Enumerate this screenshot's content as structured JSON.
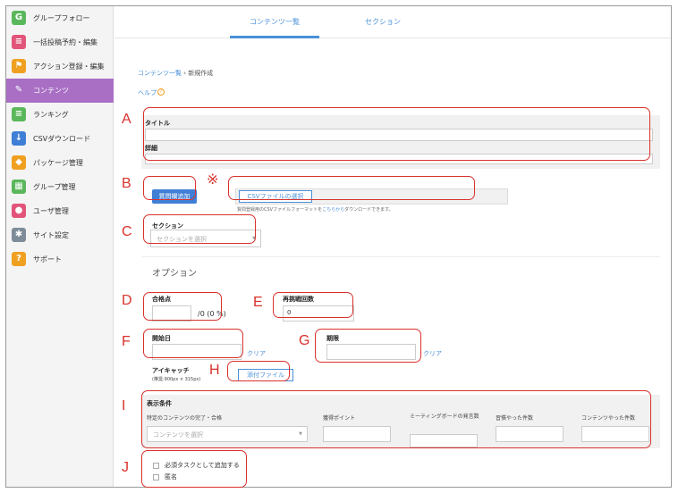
{
  "sidebar": {
    "items": [
      {
        "label": "グループフォロー",
        "icon": "group-follow-icon",
        "color": "#5bb75b",
        "glyph": "G"
      },
      {
        "label": "一括投稿予約・編集",
        "icon": "bulk-post-icon",
        "color": "#e2547a",
        "glyph": "≡"
      },
      {
        "label": "アクション登録・編集",
        "icon": "flag-icon",
        "color": "#f0a020",
        "glyph": "⚑"
      },
      {
        "label": "コンテンツ",
        "icon": "content-icon",
        "color": "#a86fc4",
        "glyph": "✎"
      },
      {
        "label": "ランキング",
        "icon": "ranking-icon",
        "color": "#5bb75b",
        "glyph": "≡"
      },
      {
        "label": "CSVダウンロード",
        "icon": "download-icon",
        "color": "#3f7fd6",
        "glyph": "↓"
      },
      {
        "label": "パッケージ管理",
        "icon": "package-icon",
        "color": "#f0a020",
        "glyph": "◆"
      },
      {
        "label": "グループ管理",
        "icon": "group-manage-icon",
        "color": "#5bb75b",
        "glyph": "▦"
      },
      {
        "label": "ユーザ管理",
        "icon": "users-icon",
        "color": "#e2547a",
        "glyph": "●"
      },
      {
        "label": "サイト設定",
        "icon": "gear-icon",
        "color": "#7e8c99",
        "glyph": "✱"
      },
      {
        "label": "サポート",
        "icon": "support-icon",
        "color": "#f0a020",
        "glyph": "?"
      }
    ],
    "active_index": 3
  },
  "tabs": [
    "コンテンツ一覧",
    "セクション"
  ],
  "breadcrumb": {
    "parent": "コンテンツ一覧",
    "separator": "›",
    "current": "新規作成"
  },
  "help": {
    "label": "ヘルプ",
    "glyph": "?"
  },
  "form": {
    "title_label": "タイトル",
    "detail_label": "詳細",
    "add_question_button": "質問欄追加",
    "csv_select_button": "CSVファイルの選択",
    "csv_hint_before": "質問登録用のCSVファイルフォーマットを",
    "csv_hint_link": "こちらから",
    "csv_hint_after": "ダウンロードできます。",
    "section_label": "セクション",
    "section_placeholder": "セクションを選択",
    "options_heading": "オプション",
    "passing_score_label": "合格点",
    "passing_score_suffix": "/0 (0 %)",
    "retry_label": "再挑戦回数",
    "retry_value": "0",
    "start_date_label": "開始日",
    "clear_label": "クリア",
    "deadline_label": "期限",
    "eyecatch_label": "アイキャッチ",
    "eyecatch_note": "(推奨:900px × 315px)",
    "attach_file_button": "添付ファイル",
    "display_conditions_label": "表示条件",
    "cond_content_label": "特定のコンテンツの完了・合格",
    "cond_content_placeholder": "コンテンツを選択",
    "cond_points_label": "獲得ポイント",
    "cond_meeting_label": "ミーティングボードの発言数",
    "cond_good_label": "習慣やった件数",
    "cond_content_done_label": "コンテンツやった件数",
    "required_task_label": "必須タスクとして追加する",
    "anonymous_label": "匿名"
  },
  "annotations": {
    "A": "A",
    "B": "B",
    "note_mark": "※",
    "C": "C",
    "D": "D",
    "E": "E",
    "F": "F",
    "G": "G",
    "H": "H",
    "I": "I",
    "J": "J",
    "color": "#d9312c"
  }
}
